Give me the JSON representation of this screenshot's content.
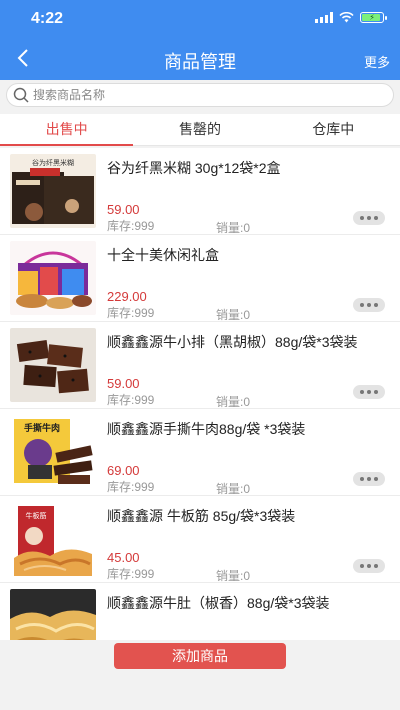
{
  "status_bar": {
    "time": "4:22"
  },
  "nav": {
    "title": "商品管理",
    "more_label": "更多"
  },
  "search": {
    "placeholder": "搜索商品名称"
  },
  "tabs": [
    {
      "label": "出售中",
      "active": true
    },
    {
      "label": "售罄的",
      "active": false
    },
    {
      "label": "仓库中",
      "active": false
    }
  ],
  "products": [
    {
      "name": "谷为纤黑米糊 30g*12袋*2盒",
      "price": "59.00",
      "stock": "库存:999",
      "sales": "销量:0",
      "thumb_text": "谷为纤黑米糊"
    },
    {
      "name": "十全十美休闲礼盒",
      "price": "229.00",
      "stock": "库存:999",
      "sales": "销量:0",
      "thumb_text": ""
    },
    {
      "name": "顺鑫鑫源牛小排（黑胡椒）88g/袋*3袋装",
      "price": "59.00",
      "stock": "库存:999",
      "sales": "销量:0",
      "thumb_text": ""
    },
    {
      "name": "顺鑫鑫源手撕牛肉88g/袋 *3袋装",
      "price": "69.00",
      "stock": "库存:999",
      "sales": "销量:0",
      "thumb_text": "手撕牛肉"
    },
    {
      "name": "顺鑫鑫源 牛板筋 85g/袋*3袋装",
      "price": "45.00",
      "stock": "库存:999",
      "sales": "销量:0",
      "thumb_text": "牛板筋"
    },
    {
      "name": "顺鑫鑫源牛肚（椒香）88g/袋*3袋装",
      "price": "",
      "stock": "",
      "sales": "",
      "thumb_text": ""
    }
  ],
  "bottom": {
    "add_label": "添加商品"
  },
  "colors": {
    "accent": "#3f8cf0",
    "active_tab": "#e24b4b",
    "price": "#d43a3a",
    "add_button": "#e2534f"
  },
  "icons": {
    "back": "chevron-left-icon",
    "search": "search-icon",
    "more": "ellipsis-icon"
  }
}
